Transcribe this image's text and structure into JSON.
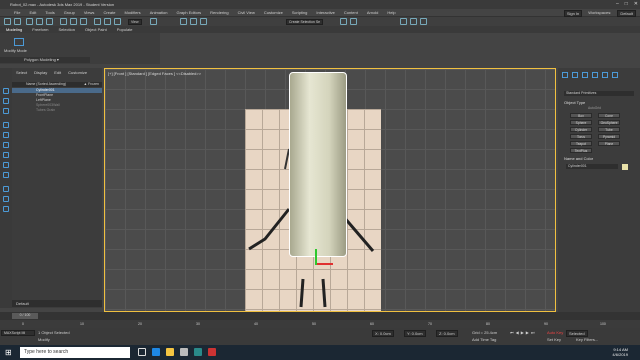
{
  "window": {
    "title": "Robot_02.max - Autodesk 3ds Max 2019 - Student Version",
    "min": "–",
    "max": "□",
    "close": "✕"
  },
  "menu": {
    "items": [
      "File",
      "Edit",
      "Tools",
      "Group",
      "Views",
      "Create",
      "Modifiers",
      "Animation",
      "Graph Editors",
      "Rendering",
      "Civil View",
      "Customize",
      "Scripting",
      "Interactive",
      "Content",
      "Arnold",
      "Help"
    ],
    "sign_in": "Sign In",
    "workspaces_label": "Workspaces:",
    "workspace": "Default"
  },
  "toolbar": {
    "selection_set": "Create Selection Se",
    "view": "View"
  },
  "ribbon": {
    "tabs": [
      "Modeling",
      "Freeform",
      "Selection",
      "Object Paint",
      "Populate"
    ],
    "group": "Modify Mode",
    "polybar": "Polygon Modeling ▾"
  },
  "scene": {
    "tabs": [
      "Select",
      "Display",
      "Edit",
      "Customize"
    ],
    "header": "Name (Sorted Ascending)",
    "header_right": "▲ Frozen",
    "rows": [
      "Cylinder001",
      "FrontPlane",
      "LeftPlane",
      "Sphere003Wall",
      "Tubes Grain"
    ]
  },
  "layer": "Default",
  "viewport": {
    "label": "[+] [Front ] [Standard ] [Edged Faces ]  <<Disabled>>"
  },
  "command_panel": {
    "category": "Standard Primitives",
    "object_type": "Object Type",
    "autogrid": "AutoGrid",
    "buttons": [
      "Box",
      "Cone",
      "Sphere",
      "GeoSphere",
      "Cylinder",
      "Tube",
      "Torus",
      "Pyramid",
      "Teapot",
      "Plane",
      "TextPlus"
    ],
    "name_color": "Name and Color",
    "object_name": "Cylinder001"
  },
  "timeline": {
    "frame": "0 / 100"
  },
  "ruler": {
    "ticks": [
      "0",
      "10",
      "20",
      "30",
      "40",
      "50",
      "60",
      "70",
      "80",
      "90",
      "100"
    ]
  },
  "status": {
    "selected": "1 Object Selected",
    "prompt": "Modify",
    "x": "X: 0.0cm",
    "y": "Y: 0.0cm",
    "z": "Z: 0.0cm",
    "grid": "Grid = 25.4cm",
    "time_tag": "Add Time Tag",
    "auto_key": "Auto Key",
    "selected_dd": "Selected",
    "set_key": "Set Key",
    "key_filters": "Key Filters...",
    "maxscript": "MAXScript Mi"
  },
  "taskbar": {
    "search": "Type here to search",
    "time": "9:14 AM",
    "date": "4/6/2019"
  }
}
